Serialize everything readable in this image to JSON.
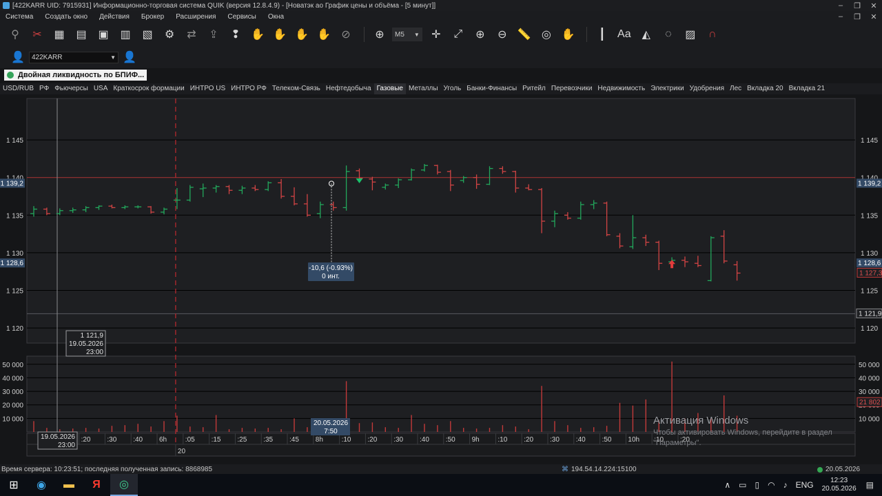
{
  "window": {
    "title": "[422KARR UID: 7915931] Информационно-торговая система QUIK (версия 12.8.4.9) - [Новатэк ао График цены и объёма - [5 минут]]",
    "controls": [
      "–",
      "❐",
      "✕"
    ]
  },
  "menu": {
    "items": [
      "Система",
      "Создать окно",
      "Действия",
      "Брокер",
      "Расширения",
      "Сервисы",
      "Окна"
    ],
    "controls": [
      "–",
      "❐",
      "✕"
    ]
  },
  "toolbar": {
    "timeframe": "M5"
  },
  "account": {
    "value": "422KARR",
    "arrow": "▼"
  },
  "instrument_tab": {
    "label": "Двойная ликвидность по  БПИФ..."
  },
  "tabs": [
    {
      "label": "USD/RUB",
      "active": false
    },
    {
      "label": "РФ",
      "active": false
    },
    {
      "label": "Фьючерсы",
      "active": false
    },
    {
      "label": "USA",
      "active": false
    },
    {
      "label": "Краткосрок формации",
      "active": false
    },
    {
      "label": "ИНТРО US",
      "active": false
    },
    {
      "label": "ИНТРО РФ",
      "active": false
    },
    {
      "label": "Телеком-Связь",
      "active": false
    },
    {
      "label": "Нефтедобыча",
      "active": false
    },
    {
      "label": "Газовые",
      "active": true
    },
    {
      "label": "Металлы",
      "active": false
    },
    {
      "label": "Уголь",
      "active": false
    },
    {
      "label": "Банки-Финансы",
      "active": false
    },
    {
      "label": "Ритейл",
      "active": false
    },
    {
      "label": "Перевозчики",
      "active": false
    },
    {
      "label": "Недвижимость",
      "active": false
    },
    {
      "label": "Электрики",
      "active": false
    },
    {
      "label": "Удобрения",
      "active": false
    },
    {
      "label": "Лес",
      "active": false
    },
    {
      "label": "Вкладка 20",
      "active": false
    },
    {
      "label": "Вкладка 21",
      "active": false
    }
  ],
  "chart_data": {
    "type": "candlestick",
    "price_axis": {
      "ticks": [
        1145,
        1140,
        1135,
        1130,
        1125,
        1120
      ],
      "tick_labels": [
        "1 145",
        "1 140",
        "1 135",
        "1 130",
        "1 125",
        "1 120"
      ],
      "range": [
        1118.0,
        1150.5
      ]
    },
    "volume_axis": {
      "ticks": [
        10000,
        20000,
        30000,
        40000,
        50000
      ],
      "tick_labels": [
        "10 000",
        "20 000",
        "30 000",
        "40 000",
        "50 000"
      ],
      "range": [
        0,
        56000
      ]
    },
    "time_axis": {
      "labels": [
        ":10",
        ":20",
        ":30",
        ":40",
        "6h",
        ":05",
        ":15",
        ":25",
        ":35",
        ":45",
        "8h",
        ":10",
        ":20",
        ":30",
        ":40",
        ":50",
        "9h",
        ":10",
        ":20",
        ":30",
        ":40",
        ":50",
        "10h",
        ":10",
        ":20"
      ],
      "label_bar_index": [
        2,
        4,
        6,
        8,
        10,
        12,
        14,
        16,
        18,
        20,
        22,
        24,
        26,
        28,
        30,
        32,
        34,
        36,
        38,
        40,
        42,
        44,
        46,
        48,
        50
      ],
      "date_row": "20"
    },
    "candles": [
      {
        "o": 1135.2,
        "h": 1136.2,
        "l": 1134.8,
        "c": 1135.8
      },
      {
        "o": 1135.8,
        "h": 1136.0,
        "l": 1135.0,
        "c": 1135.2
      },
      {
        "o": 1135.2,
        "h": 1135.9,
        "l": 1135.0,
        "c": 1135.6
      },
      {
        "o": 1135.6,
        "h": 1136.0,
        "l": 1135.3,
        "c": 1135.7
      },
      {
        "o": 1135.7,
        "h": 1136.2,
        "l": 1135.4,
        "c": 1136.0
      },
      {
        "o": 1136.0,
        "h": 1136.3,
        "l": 1135.7,
        "c": 1136.2
      },
      {
        "o": 1136.2,
        "h": 1136.4,
        "l": 1135.9,
        "c": 1136.0
      },
      {
        "o": 1136.0,
        "h": 1136.3,
        "l": 1135.8,
        "c": 1136.1
      },
      {
        "o": 1136.1,
        "h": 1136.3,
        "l": 1135.9,
        "c": 1136.1
      },
      {
        "o": 1136.1,
        "h": 1136.2,
        "l": 1135.2,
        "c": 1135.4
      },
      {
        "o": 1135.4,
        "h": 1136.0,
        "l": 1135.1,
        "c": 1135.8
      },
      {
        "o": 1137.0,
        "h": 1138.6,
        "l": 1135.8,
        "c": 1137.0
      },
      {
        "o": 1137.0,
        "h": 1139.0,
        "l": 1136.8,
        "c": 1138.7
      },
      {
        "o": 1138.5,
        "h": 1139.2,
        "l": 1137.4,
        "c": 1138.6
      },
      {
        "o": 1138.6,
        "h": 1139.0,
        "l": 1138.0,
        "c": 1138.8
      },
      {
        "o": 1138.8,
        "h": 1139.0,
        "l": 1137.8,
        "c": 1138.3
      },
      {
        "o": 1138.3,
        "h": 1138.9,
        "l": 1137.8,
        "c": 1138.6
      },
      {
        "o": 1138.6,
        "h": 1139.0,
        "l": 1138.2,
        "c": 1138.4
      },
      {
        "o": 1138.4,
        "h": 1139.5,
        "l": 1138.2,
        "c": 1139.3
      },
      {
        "o": 1139.3,
        "h": 1139.8,
        "l": 1137.2,
        "c": 1137.5
      },
      {
        "o": 1137.5,
        "h": 1138.7,
        "l": 1136.3,
        "c": 1136.5
      },
      {
        "o": 1136.5,
        "h": 1137.8,
        "l": 1134.8,
        "c": 1135.0
      },
      {
        "o": 1135.2,
        "h": 1136.8,
        "l": 1134.6,
        "c": 1136.4
      },
      {
        "o": 1136.4,
        "h": 1136.8,
        "l": 1135.6,
        "c": 1136.0
      },
      {
        "o": 1136.0,
        "h": 1141.6,
        "l": 1135.6,
        "c": 1140.8
      },
      {
        "o": 1140.9,
        "h": 1141.2,
        "l": 1139.6,
        "c": 1139.9
      },
      {
        "o": 1139.8,
        "h": 1140.1,
        "l": 1138.3,
        "c": 1139.4
      },
      {
        "o": 1138.7,
        "h": 1139.2,
        "l": 1138.4,
        "c": 1139.0
      },
      {
        "o": 1139.0,
        "h": 1139.9,
        "l": 1138.6,
        "c": 1139.7
      },
      {
        "o": 1139.7,
        "h": 1141.2,
        "l": 1139.6,
        "c": 1141.0
      },
      {
        "o": 1141.0,
        "h": 1141.8,
        "l": 1140.8,
        "c": 1141.6
      },
      {
        "o": 1141.6,
        "h": 1141.7,
        "l": 1140.4,
        "c": 1140.7
      },
      {
        "o": 1140.8,
        "h": 1141.0,
        "l": 1138.2,
        "c": 1139.0
      },
      {
        "o": 1139.6,
        "h": 1140.2,
        "l": 1139.3,
        "c": 1140.0
      },
      {
        "o": 1140.0,
        "h": 1140.4,
        "l": 1138.5,
        "c": 1139.1
      },
      {
        "o": 1139.1,
        "h": 1141.5,
        "l": 1139.0,
        "c": 1141.2
      },
      {
        "o": 1141.2,
        "h": 1141.5,
        "l": 1140.5,
        "c": 1140.8
      },
      {
        "o": 1140.8,
        "h": 1140.9,
        "l": 1138.0,
        "c": 1138.6
      },
      {
        "o": 1138.6,
        "h": 1139.1,
        "l": 1138.3,
        "c": 1138.4
      },
      {
        "o": 1138.4,
        "h": 1138.6,
        "l": 1132.6,
        "c": 1134.2
      },
      {
        "o": 1134.2,
        "h": 1135.6,
        "l": 1133.4,
        "c": 1135.2
      },
      {
        "o": 1135.0,
        "h": 1135.4,
        "l": 1134.4,
        "c": 1134.6
      },
      {
        "o": 1134.6,
        "h": 1136.8,
        "l": 1134.4,
        "c": 1136.4
      },
      {
        "o": 1136.4,
        "h": 1137.0,
        "l": 1135.8,
        "c": 1136.6
      },
      {
        "o": 1136.6,
        "h": 1136.8,
        "l": 1132.2,
        "c": 1132.4
      },
      {
        "o": 1132.2,
        "h": 1132.6,
        "l": 1130.6,
        "c": 1130.9
      },
      {
        "o": 1130.8,
        "h": 1135.0,
        "l": 1130.5,
        "c": 1132.0
      },
      {
        "o": 1132.0,
        "h": 1132.4,
        "l": 1130.9,
        "c": 1131.4
      },
      {
        "o": 1131.4,
        "h": 1131.6,
        "l": 1127.7,
        "c": 1128.6
      },
      {
        "o": 1128.8,
        "h": 1129.4,
        "l": 1128.0,
        "c": 1129.0
      },
      {
        "o": 1129.0,
        "h": 1129.5,
        "l": 1128.1,
        "c": 1128.8
      },
      {
        "o": 1128.6,
        "h": 1129.6,
        "l": 1128.1,
        "c": 1128.3
      },
      {
        "o": 1126.3,
        "h": 1132.2,
        "l": 1126.2,
        "c": 1132.0
      },
      {
        "o": 1132.2,
        "h": 1133.0,
        "l": 1128.6,
        "c": 1128.9
      },
      {
        "o": 1128.4,
        "h": 1128.9,
        "l": 1126.3,
        "c": 1127.3
      }
    ],
    "volumes": [
      8000,
      3000,
      2000,
      2500,
      3000,
      2500,
      4500,
      5000,
      6000,
      4000,
      8000,
      12000,
      4000,
      3500,
      12500,
      2000,
      3000,
      2500,
      3000,
      2000,
      10000,
      3500,
      2500,
      3500,
      37500,
      6500,
      7000,
      3500,
      3000,
      12500,
      6000,
      5000,
      8000,
      3000,
      2500,
      3000,
      5000,
      4000,
      2000,
      34000,
      8000,
      5000,
      3000,
      3500,
      4500,
      21500,
      19500,
      24000,
      8500,
      52000,
      10000,
      14000,
      10000,
      27000,
      12000
    ],
    "last_price": {
      "value": 1127.3,
      "label": "1 127,3"
    },
    "horizontal_lines": [
      {
        "value": 1140.0,
        "color": "#b23a3a"
      }
    ],
    "crosshair_price_label": "1 139,2",
    "crosshair_price": 1139.2,
    "range_low_label": "1 128,6",
    "range_low": 1128.6,
    "bottom_right_label": "1 121,9",
    "bottom_right_price": 1121.9,
    "volume_last_label": "21 802",
    "volume_last": 21802,
    "measure_label": {
      "line1": "-10,6 (-0.93%)",
      "line2": "0 инт."
    },
    "cursor_price_box": {
      "price": "1 121,9",
      "date": "19.05.2026",
      "time": "23:00"
    },
    "cursor_time_label": {
      "date": "19.05.2026",
      "time": "23:00"
    },
    "measure_time_label": {
      "date": "20.05.2026",
      "time": "7:50"
    },
    "session_separator_bar": 11,
    "markers": [
      {
        "bar": 25,
        "type": "down-triangle",
        "color": "#19c26a",
        "price": 1139.6
      },
      {
        "bar": 49,
        "type": "up-arrow",
        "color": "#e23b3b",
        "price": 1128.5
      }
    ],
    "colors": {
      "up": "#22a85c",
      "down": "#d24444",
      "grid": "#000000",
      "bg": "#1e1f22"
    }
  },
  "watermark": {
    "line1": "Активация Windows",
    "line2": "Чтобы активировать Windows, перейдите в раздел",
    "line3": "\"Параметры\"."
  },
  "status": {
    "server_time": "Время сервера: 10:23:51; последняя полученная запись: 8868985",
    "connection": "194.54.14.224:15100",
    "date": "20.05.2026"
  },
  "taskbar": {
    "tray_lang": "ENG",
    "time": "12:23",
    "date": "20.05.2026"
  }
}
